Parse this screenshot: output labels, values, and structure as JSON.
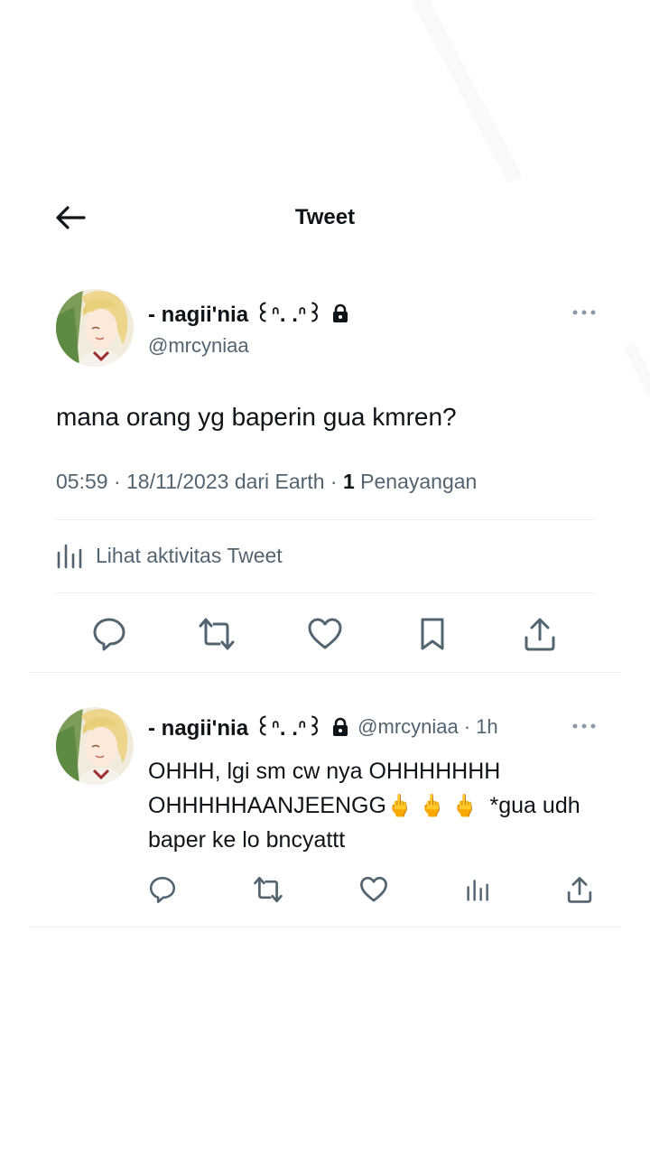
{
  "header": {
    "title": "Tweet"
  },
  "tweet": {
    "display_name": "- nagii'nia ꒰ᐢ. .ᐢ꒱",
    "handle": "@mrcyniaa",
    "text": "mana orang yg baperin gua kmren?",
    "time": "05:59",
    "date": "18/11/2023",
    "source": "dari Earth",
    "views_count": "1",
    "views_label": "Penayangan",
    "activity_label": "Lihat aktivitas Tweet"
  },
  "reply": {
    "display_name": "- nagii'nia ꒰ᐢ. .ᐢ꒱",
    "handle": "@mrcyniaa",
    "time": "1h",
    "text_before": "OHHH, lgi sm cw nya OHHHHHHH OHHHHHAANJEENGG",
    "emoji": "🖕🖕🖕",
    "text_after": " *gua udh baper ke lo bncyattt"
  },
  "separator": "·",
  "colors": {
    "text": "#0f1419",
    "muted": "#536471",
    "divider": "#eff3f4"
  }
}
